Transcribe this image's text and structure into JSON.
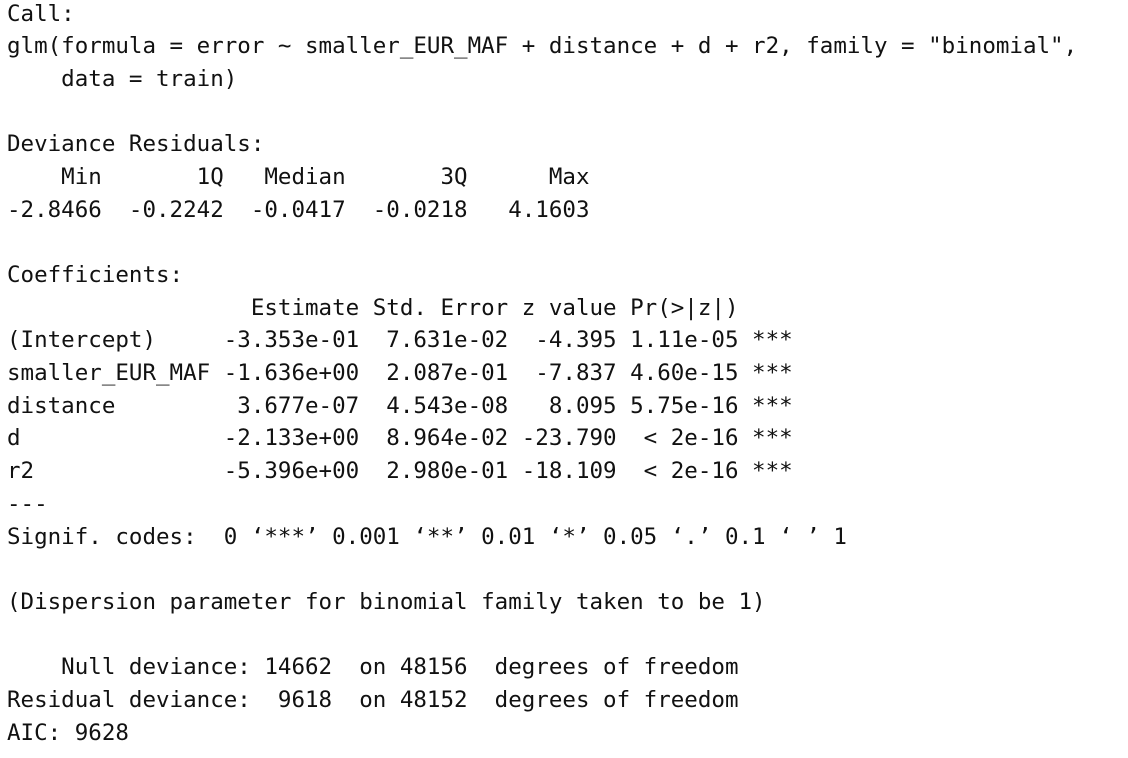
{
  "call": {
    "header": "Call:",
    "line1": "glm(formula = error ~ smaller_EUR_MAF + distance + d + r2, family = \"binomial\",",
    "line2": "    data = train)"
  },
  "deviance_residuals": {
    "header": "Deviance Residuals:",
    "labels_line": "    Min       1Q   Median       3Q      Max  ",
    "values_line": "-2.8466  -0.2242  -0.0417  -0.0218   4.1603  ",
    "labels": [
      "Min",
      "1Q",
      "Median",
      "3Q",
      "Max"
    ],
    "values": [
      "-2.8466",
      "-0.2242",
      "-0.0417",
      "-0.0218",
      "4.1603"
    ]
  },
  "coefficients": {
    "header": "Coefficients:",
    "column_header_line": "                  Estimate Std. Error z value Pr(>|z|)    ",
    "columns": [
      "Estimate",
      "Std. Error",
      "z value",
      "Pr(>|z|)"
    ],
    "row_lines": [
      "(Intercept)     -3.353e-01  7.631e-02  -4.395 1.11e-05 ***",
      "smaller_EUR_MAF -1.636e+00  2.087e-01  -7.837 4.60e-15 ***",
      "distance         3.677e-07  4.543e-08   8.095 5.75e-16 ***",
      "d               -2.133e+00  8.964e-02 -23.790  < 2e-16 ***",
      "r2              -5.396e+00  2.980e-01 -18.109  < 2e-16 ***"
    ],
    "rows": [
      {
        "term": "(Intercept)",
        "estimate": "-3.353e-01",
        "std_error": "7.631e-02",
        "z_value": "-4.395",
        "p_value": "1.11e-05",
        "signif": "***"
      },
      {
        "term": "smaller_EUR_MAF",
        "estimate": "-1.636e+00",
        "std_error": "2.087e-01",
        "z_value": "-7.837",
        "p_value": "4.60e-15",
        "signif": "***"
      },
      {
        "term": "distance",
        "estimate": "3.677e-07",
        "std_error": "4.543e-08",
        "z_value": "8.095",
        "p_value": "5.75e-16",
        "signif": "***"
      },
      {
        "term": "d",
        "estimate": "-2.133e+00",
        "std_error": "8.964e-02",
        "z_value": "-23.790",
        "p_value": "< 2e-16",
        "signif": "***"
      },
      {
        "term": "r2",
        "estimate": "-5.396e+00",
        "std_error": "2.980e-01",
        "z_value": "-18.109",
        "p_value": "< 2e-16",
        "signif": "***"
      }
    ],
    "separator": "---",
    "signif_codes": "Signif. codes:  0 ‘***’ 0.001 ‘**’ 0.01 ‘*’ 0.05 ‘.’ 0.1 ‘ ’ 1"
  },
  "dispersion": "(Dispersion parameter for binomial family taken to be 1)",
  "deviance": {
    "null_line": "    Null deviance: 14662  on 48156  degrees of freedom",
    "residual_line": "Residual deviance:  9618  on 48152  degrees of freedom",
    "null_value": "14662",
    "null_df": "48156",
    "residual_value": "9618",
    "residual_df": "48152"
  },
  "aic": "AIC: 9628"
}
